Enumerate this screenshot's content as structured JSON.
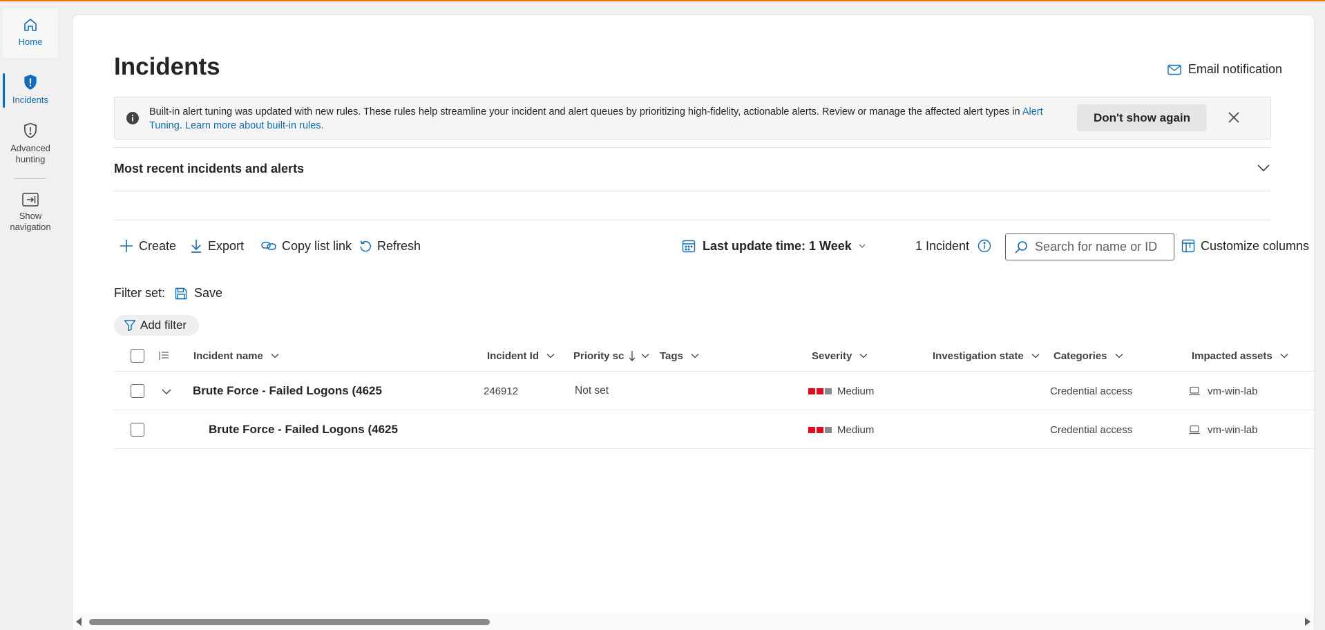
{
  "rail": {
    "home_label": "Home",
    "incidents_label": "Incidents",
    "hunting_label_1": "Advanced",
    "hunting_label_2": "hunting",
    "shownav_label_1": "Show",
    "shownav_label_2": "navigation"
  },
  "page": {
    "title": "Incidents",
    "email_notification": "Email notification"
  },
  "banner": {
    "text": "Built-in alert tuning was updated with new rules. These rules help streamline your incident and alert queues by prioritizing high-fidelity, actionable alerts. Review or manage the affected alert types in ",
    "link1": "Alert Tuning",
    "sep": ". ",
    "link2": "Learn more about built-in rules.",
    "dont_show_again": "Don't show again"
  },
  "recent": {
    "title": "Most recent incidents and alerts"
  },
  "toolbar": {
    "create": "Create",
    "export": "Export",
    "copy_link": "Copy list link",
    "refresh": "Refresh",
    "time_filter": "Last update time: 1 Week",
    "incident_count": "1 Incident",
    "search_placeholder": "Search for name or ID",
    "customize": "Customize columns"
  },
  "filters": {
    "filter_set_label": "Filter set:",
    "save": "Save",
    "add_filter": "Add filter"
  },
  "table": {
    "columns": {
      "name": "Incident name",
      "id": "Incident Id",
      "priority": "Priority sc",
      "tags": "Tags",
      "severity": "Severity",
      "investigation": "Investigation state",
      "categories": "Categories",
      "assets": "Impacted assets"
    },
    "rows": [
      {
        "name": "Brute Force - Failed Logons (4625",
        "id": "246912",
        "priority": "Not set",
        "severity": "Medium",
        "category": "Credential access",
        "asset": "vm-win-lab"
      },
      {
        "name": "Brute Force - Failed Logons (4625",
        "severity": "Medium",
        "category": "Credential access",
        "asset": "vm-win-lab"
      }
    ]
  },
  "colors": {
    "accent": "#0f6cbd",
    "top_bar": "#e8740c",
    "severity_high": "#e00b1c",
    "severity_low": "#8a8a8a"
  },
  "icons": {
    "home": "home-icon",
    "incidents": "shield-alert-icon",
    "hunting": "shield-outline-icon",
    "nav": "show-navigation-icon",
    "mail": "mail-icon",
    "info": "info-icon",
    "close": "close-icon",
    "chevron": "chevron-down-icon",
    "plus": "plus-icon",
    "export": "download-icon",
    "link": "link-icon",
    "refresh": "refresh-icon",
    "calendar": "calendar-icon",
    "search": "search-icon",
    "columns": "columns-icon",
    "save": "save-icon",
    "filter": "filter-icon",
    "laptop": "laptop-icon"
  }
}
